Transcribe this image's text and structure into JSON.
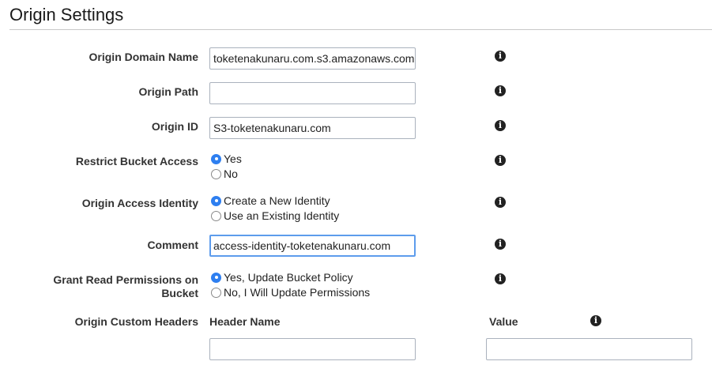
{
  "section": {
    "title": "Origin Settings"
  },
  "fields": {
    "origin_domain_name": {
      "label": "Origin Domain Name",
      "value": "toketenakunaru.com.s3.amazonaws.com"
    },
    "origin_path": {
      "label": "Origin Path",
      "value": ""
    },
    "origin_id": {
      "label": "Origin ID",
      "value": "S3-toketenakunaru.com"
    },
    "restrict_bucket_access": {
      "label": "Restrict Bucket Access",
      "options": [
        "Yes",
        "No"
      ],
      "selected": "Yes"
    },
    "origin_access_identity": {
      "label": "Origin Access Identity",
      "options": [
        "Create a New Identity",
        "Use an Existing Identity"
      ],
      "selected": "Create a New Identity"
    },
    "comment": {
      "label": "Comment",
      "value": "access-identity-toketenakunaru.com"
    },
    "grant_read_permissions": {
      "label_line1": "Grant Read Permissions on",
      "label_line2": "Bucket",
      "options": [
        "Yes, Update Bucket Policy",
        "No, I Will Update Permissions"
      ],
      "selected": "Yes, Update Bucket Policy"
    },
    "origin_custom_headers": {
      "label": "Origin Custom Headers",
      "header_name_label": "Header Name",
      "value_label": "Value",
      "header_name_value": "",
      "value_value": ""
    }
  },
  "icons": {
    "info": "info-icon"
  },
  "colors": {
    "radio_selected": "#2e7ff0",
    "focus_border": "#5d9cec"
  }
}
